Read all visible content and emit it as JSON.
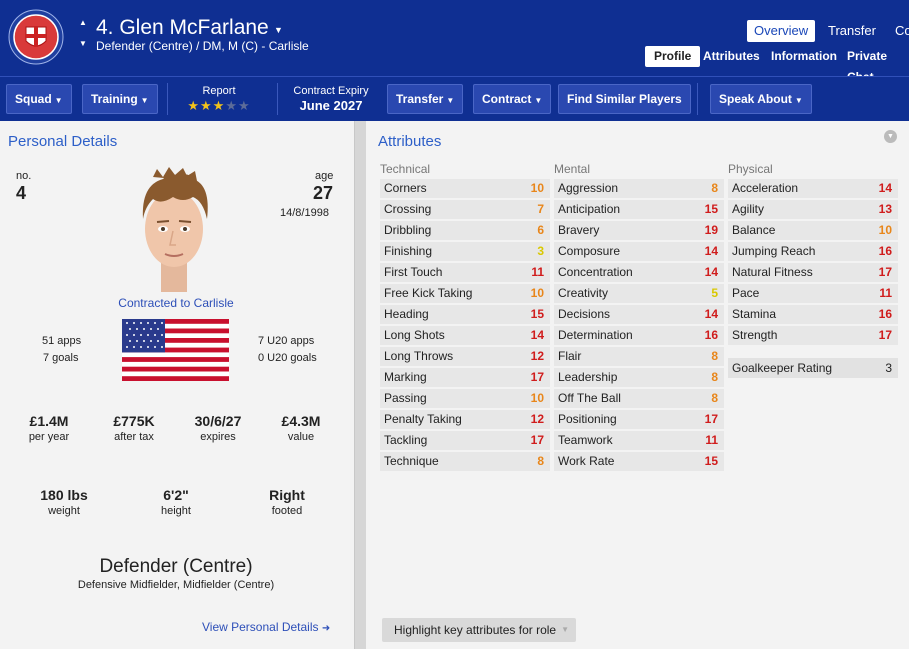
{
  "header": {
    "title": "4. Glen McFarlane",
    "subtitle": "Defender (Centre) / DM, M (C) - Carlisle",
    "tabs": [
      "Overview",
      "Transfer",
      "Co"
    ],
    "subtabs": [
      "Profile",
      "Attributes",
      "Information",
      "Private Chat"
    ]
  },
  "toolbar": {
    "squad": "Squad",
    "training": "Training",
    "report_label": "Report",
    "report_stars": 3,
    "report_max_stars": 5,
    "contract_label": "Contract Expiry",
    "contract_value": "June 2027",
    "transfer": "Transfer",
    "contract": "Contract",
    "find_similar": "Find Similar Players",
    "speak_about": "Speak About"
  },
  "personal": {
    "title": "Personal Details",
    "no_label": "no.",
    "no_value": "4",
    "age_label": "age",
    "age_value": "27",
    "dob": "14/8/1998",
    "contract_status": "Contracted to Carlisle",
    "apps": "51 apps",
    "goals": "7 goals",
    "u20_apps": "7 U20 apps",
    "u20_goals": "0 U20 goals",
    "wage_value": "£1.4M",
    "wage_label": "per year",
    "after_tax_value": "£775K",
    "after_tax_label": "after tax",
    "expires_value": "30/6/27",
    "expires_label": "expires",
    "value_value": "£4.3M",
    "value_label": "value",
    "weight_value": "180 lbs",
    "weight_label": "weight",
    "height_value": "6'2\"",
    "height_label": "height",
    "foot_value": "Right",
    "foot_label": "footed",
    "position": "Defender (Centre)",
    "other_positions": "Defensive Midfielder, Midfielder (Centre)",
    "view_link": "View Personal Details"
  },
  "attributes": {
    "title": "Attributes",
    "technical_label": "Technical",
    "mental_label": "Mental",
    "physical_label": "Physical",
    "technical": [
      {
        "name": "Corners",
        "value": "10",
        "color": "orange"
      },
      {
        "name": "Crossing",
        "value": "7",
        "color": "orange"
      },
      {
        "name": "Dribbling",
        "value": "6",
        "color": "orange"
      },
      {
        "name": "Finishing",
        "value": "3",
        "color": "yellow"
      },
      {
        "name": "First Touch",
        "value": "11",
        "color": "red"
      },
      {
        "name": "Free Kick Taking",
        "value": "10",
        "color": "orange"
      },
      {
        "name": "Heading",
        "value": "15",
        "color": "red"
      },
      {
        "name": "Long Shots",
        "value": "14",
        "color": "red"
      },
      {
        "name": "Long Throws",
        "value": "12",
        "color": "red"
      },
      {
        "name": "Marking",
        "value": "17",
        "color": "red"
      },
      {
        "name": "Passing",
        "value": "10",
        "color": "orange"
      },
      {
        "name": "Penalty Taking",
        "value": "12",
        "color": "red"
      },
      {
        "name": "Tackling",
        "value": "17",
        "color": "red"
      },
      {
        "name": "Technique",
        "value": "8",
        "color": "orange"
      }
    ],
    "mental": [
      {
        "name": "Aggression",
        "value": "8",
        "color": "orange"
      },
      {
        "name": "Anticipation",
        "value": "15",
        "color": "red"
      },
      {
        "name": "Bravery",
        "value": "19",
        "color": "red"
      },
      {
        "name": "Composure",
        "value": "14",
        "color": "red"
      },
      {
        "name": "Concentration",
        "value": "14",
        "color": "red"
      },
      {
        "name": "Creativity",
        "value": "5",
        "color": "yellow"
      },
      {
        "name": "Decisions",
        "value": "14",
        "color": "red"
      },
      {
        "name": "Determination",
        "value": "16",
        "color": "red"
      },
      {
        "name": "Flair",
        "value": "8",
        "color": "orange"
      },
      {
        "name": "Leadership",
        "value": "8",
        "color": "orange"
      },
      {
        "name": "Off The Ball",
        "value": "8",
        "color": "orange"
      },
      {
        "name": "Positioning",
        "value": "17",
        "color": "red"
      },
      {
        "name": "Teamwork",
        "value": "11",
        "color": "red"
      },
      {
        "name": "Work Rate",
        "value": "15",
        "color": "red"
      }
    ],
    "physical": [
      {
        "name": "Acceleration",
        "value": "14",
        "color": "red"
      },
      {
        "name": "Agility",
        "value": "13",
        "color": "red"
      },
      {
        "name": "Balance",
        "value": "10",
        "color": "orange"
      },
      {
        "name": "Jumping Reach",
        "value": "16",
        "color": "red"
      },
      {
        "name": "Natural Fitness",
        "value": "17",
        "color": "red"
      },
      {
        "name": "Pace",
        "value": "11",
        "color": "red"
      },
      {
        "name": "Stamina",
        "value": "16",
        "color": "red"
      },
      {
        "name": "Strength",
        "value": "17",
        "color": "red"
      }
    ],
    "gk_label": "Goalkeeper Rating",
    "gk_value": "3",
    "highlight_button": "Highlight key attributes for role"
  }
}
